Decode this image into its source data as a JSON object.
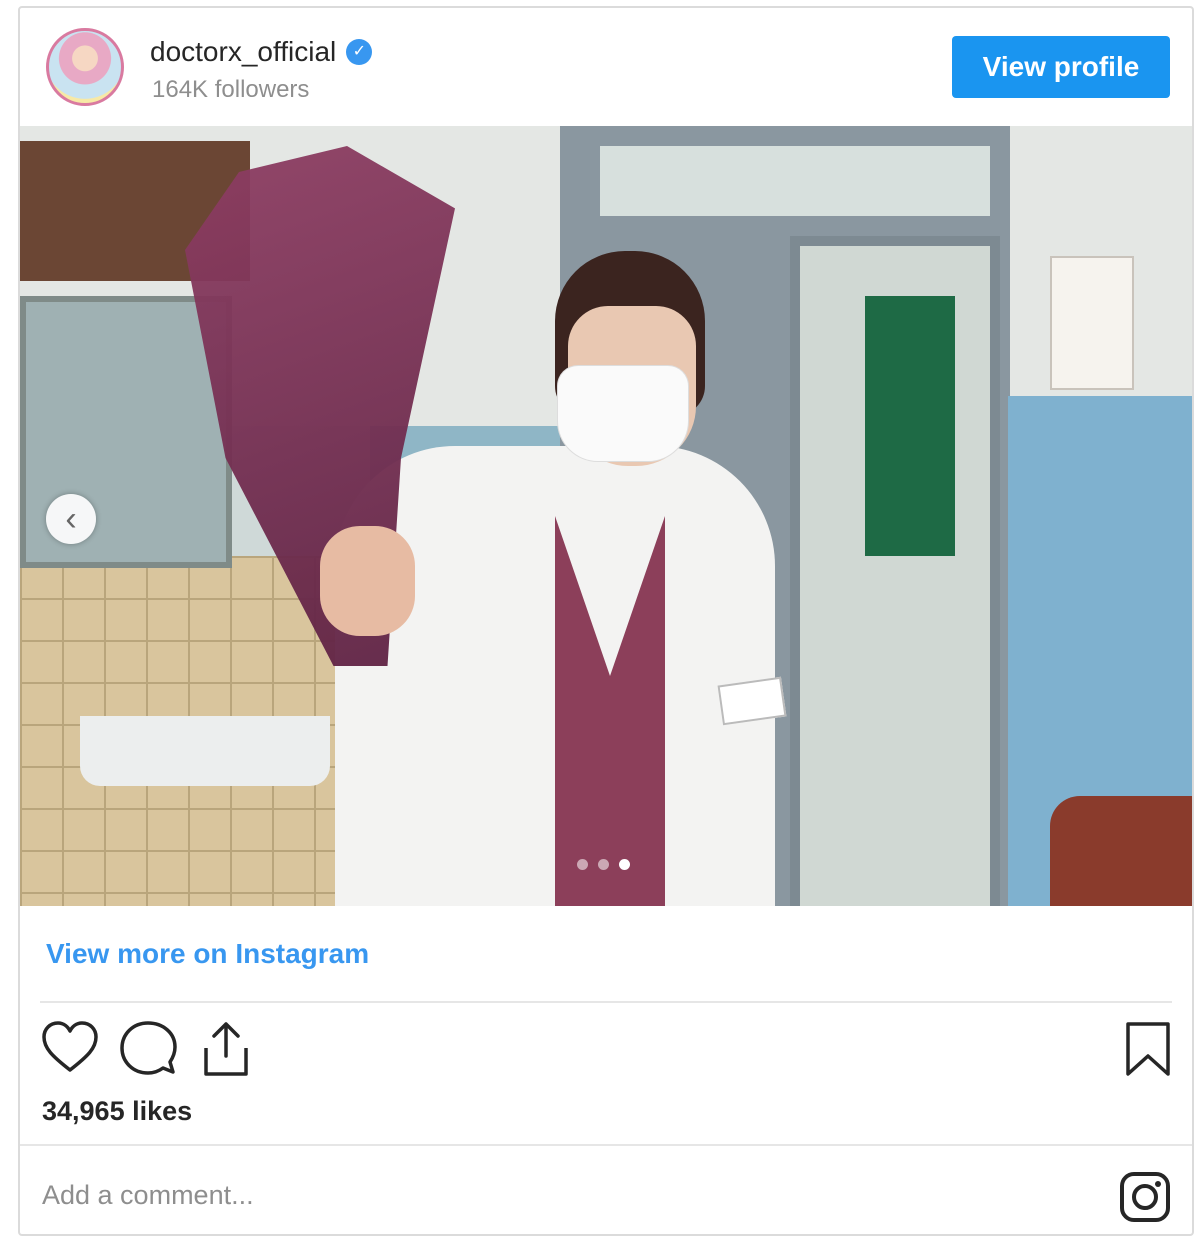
{
  "header": {
    "username": "doctorx_official",
    "verified_glyph": "✓",
    "followers": "164K followers",
    "view_profile_label": "View profile"
  },
  "carousel": {
    "prev_glyph": "‹",
    "slide_count": 3,
    "active_slide": 3
  },
  "links": {
    "view_more": "View more on Instagram"
  },
  "engagement": {
    "likes": "34,965 likes"
  },
  "comment": {
    "placeholder": "Add a comment..."
  },
  "colors": {
    "accent": "#3897f0",
    "button": "#1a95f0"
  },
  "icons": [
    "heart-icon",
    "comment-icon",
    "share-icon",
    "bookmark-icon",
    "instagram-icon",
    "verified-icon"
  ]
}
